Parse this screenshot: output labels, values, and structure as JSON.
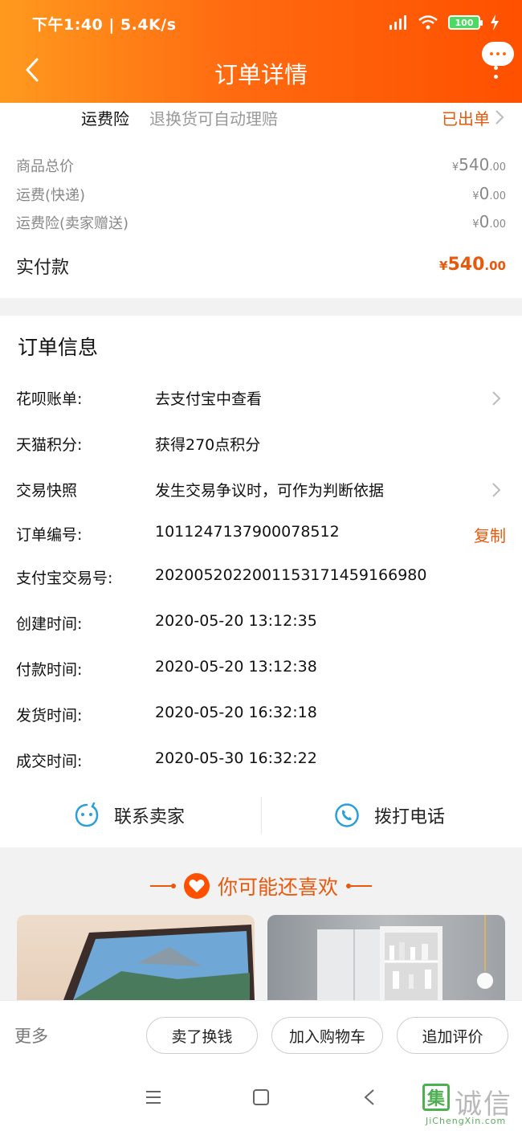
{
  "status_bar": {
    "left": "下午1:40 | 5.4K/s",
    "battery": "100"
  },
  "header": {
    "title": "订单详情"
  },
  "insurance": {
    "label": "运费险",
    "desc": "退换货可自动理赔",
    "status": "已出单"
  },
  "prices": {
    "items": [
      {
        "label": "商品总价",
        "int": "540",
        "dec": ".00"
      },
      {
        "label": "运费(快递)",
        "int": "0",
        "dec": ".00"
      },
      {
        "label": "运费险(卖家赠送)",
        "int": "0",
        "dec": ".00"
      }
    ],
    "total": {
      "label": "实付款",
      "int": "540",
      "dec": ".00"
    },
    "currency": "¥"
  },
  "order_info": {
    "title": "订单信息",
    "rows": [
      {
        "label": "花呗账单:",
        "value": "去支付宝中查看"
      },
      {
        "label": "天猫积分:",
        "value": "获得270点积分"
      },
      {
        "label": "交易快照",
        "value": "发生交易争议时，可作为判断依据"
      },
      {
        "label": "订单编号:",
        "value": "1011247137900078512",
        "action": "复制"
      },
      {
        "label": "支付宝交易号:",
        "value": "2020052022001153171459166980"
      },
      {
        "label": "创建时间:",
        "value": "2020-05-20 13:12:35"
      },
      {
        "label": "付款时间:",
        "value": "2020-05-20 13:12:38"
      },
      {
        "label": "发货时间:",
        "value": "2020-05-20 16:32:18"
      },
      {
        "label": "成交时间:",
        "value": "2020-05-30 16:32:22"
      }
    ]
  },
  "contact": {
    "seller": "联系卖家",
    "phone": "拨打电话"
  },
  "recommend": {
    "title": "你可能还喜欢"
  },
  "actions": {
    "more": "更多",
    "sell": "卖了换钱",
    "add_cart": "加入购物车",
    "review": "追加评价"
  },
  "watermark": {
    "mark": "集",
    "name": "诚信",
    "url": "JiChengXin.com"
  },
  "colors": {
    "accent": "#e8590c",
    "header_start": "#ff9a1e",
    "header_end": "#ff5000"
  }
}
